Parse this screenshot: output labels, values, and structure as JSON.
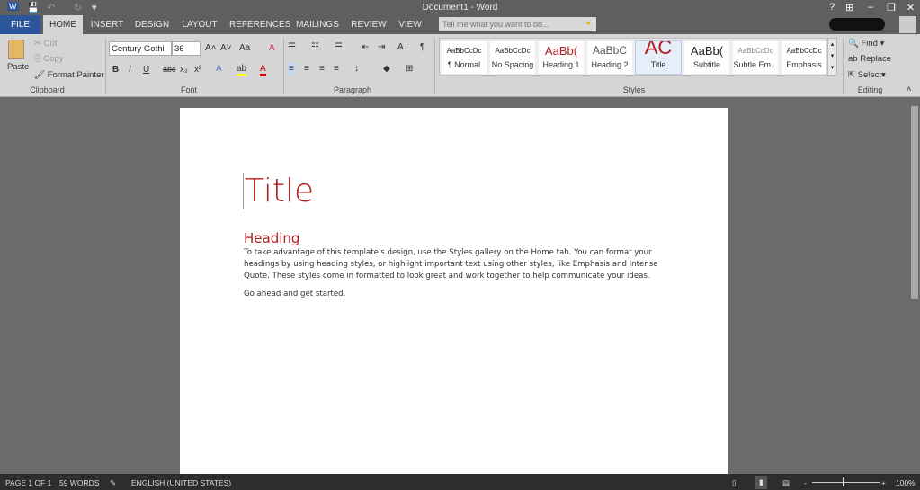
{
  "window": {
    "title": "Document1 - Word",
    "help": "?",
    "ribbon_options": "⊞",
    "minimize": "–",
    "restore": "❐",
    "close": "✕"
  },
  "quick_access": {
    "word": "W",
    "save": "💾",
    "undo": "↶",
    "redo": "↻",
    "customize": "▾"
  },
  "tabs": [
    "FILE",
    "HOME",
    "INSERT",
    "DESIGN",
    "LAYOUT",
    "REFERENCES",
    "MAILINGS",
    "REVIEW",
    "VIEW"
  ],
  "tell_me": {
    "placeholder": "Tell me what you want to do..."
  },
  "clipboard": {
    "paste": "Paste",
    "cut": "Cut",
    "copy": "Copy",
    "format_painter": "Format Painter",
    "label": "Clipboard"
  },
  "font": {
    "name": "Century Gothi",
    "size": "36",
    "grow": "A˄",
    "shrink": "A˅",
    "case": "Aa",
    "clear": "A",
    "bold": "B",
    "italic": "I",
    "underline": "U",
    "strike": "abc",
    "sub": "x₂",
    "sup": "x²",
    "effects": "A",
    "highlight": "ab",
    "color": "A",
    "label": "Font"
  },
  "paragraph": {
    "label": "Paragraph",
    "bullets": "☰",
    "numbering": "☷",
    "multilevel": "☰",
    "dec_indent": "⇤",
    "inc_indent": "⇥",
    "sort": "A↓",
    "pilcrow": "¶",
    "left": "≡",
    "center": "≡",
    "right": "≡",
    "justify": "≡",
    "spacing": "↕",
    "shading": "◆",
    "borders": "⊞"
  },
  "styles": {
    "label": "Styles",
    "items": [
      {
        "preview": "AaBbCcDc",
        "name": "¶ Normal"
      },
      {
        "preview": "AaBbCcDc",
        "name": "No Spacing"
      },
      {
        "preview": "AaBb(",
        "name": "Heading 1"
      },
      {
        "preview": "AaBbC",
        "name": "Heading 2"
      },
      {
        "preview": "AC",
        "name": "Title"
      },
      {
        "preview": "AaBb(",
        "name": "Subtitle"
      },
      {
        "preview": "AaBbCcDc",
        "name": "Subtle Em..."
      },
      {
        "preview": "AaBbCcDc",
        "name": "Emphasis"
      }
    ]
  },
  "editing": {
    "find": "Find",
    "replace": "Replace",
    "select": "Select",
    "label": "Editing"
  },
  "document": {
    "title": "Title",
    "heading": "Heading",
    "body": "To take advantage of this template's design, use the Styles gallery on the Home tab. You can format your headings by using heading styles, or highlight important text using other styles, like Emphasis and Intense Quote. These styles come in formatted to look great and work together to help communicate your ideas.",
    "closing": "Go ahead and get started."
  },
  "status": {
    "page": "PAGE 1 OF 1",
    "words": "59 WORDS",
    "language": "ENGLISH (UNITED STATES)",
    "zoom": "100%",
    "zoom_minus": "-",
    "zoom_plus": "+"
  },
  "colors": {
    "accent": "#2b579a",
    "heading": "#b21e1e"
  }
}
